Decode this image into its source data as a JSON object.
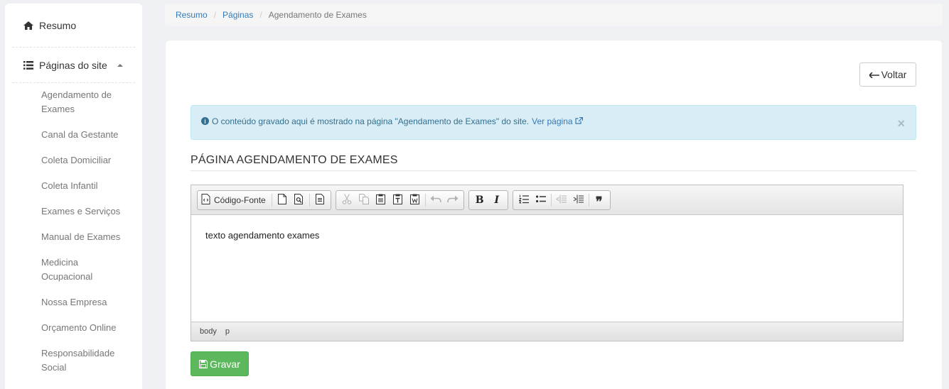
{
  "sidebar": {
    "home_label": "Resumo",
    "pages_label": "Páginas do site",
    "pages": [
      "Agendamento de Exames",
      "Canal da Gestante",
      "Coleta Domiciliar",
      "Coleta Infantil",
      "Exames e Serviços",
      "Manual de Exames",
      "Medicina Ocupacional",
      "Nossa Empresa",
      "Orçamento Online",
      "Responsabilidade Social"
    ]
  },
  "breadcrumb": {
    "items": [
      "Resumo",
      "Páginas"
    ],
    "current": "Agendamento de Exames",
    "separator": "/"
  },
  "main": {
    "back_label": "Voltar",
    "alert": {
      "text": "O conteúdo gravado aqui é mostrado na página \"Agendamento de Exames\" do site.",
      "link_label": "Ver página",
      "close": "×"
    },
    "heading": "PÁGINA AGENDAMENTO DE EXAMES",
    "editor": {
      "source_label": "Código-Fonte",
      "bold": "B",
      "italic": "I",
      "blockquote": "❞",
      "content": "texto agendamento exames",
      "path": [
        "body",
        "p"
      ]
    },
    "save_label": "Gravar"
  },
  "colors": {
    "link": "#337ab7",
    "alert_bg": "#d9edf7",
    "save_button": "#5cb85c"
  }
}
